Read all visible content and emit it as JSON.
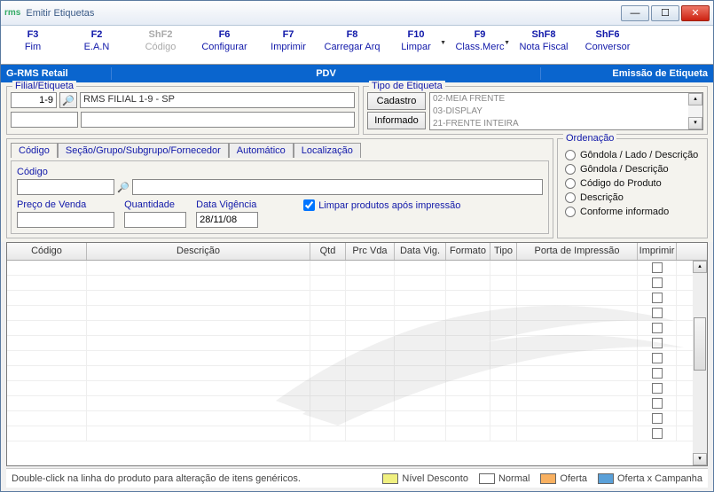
{
  "window": {
    "title": "Emitir Etiquetas"
  },
  "toolbar": [
    {
      "shortcut": "F3",
      "label": "Fim",
      "disabled": false
    },
    {
      "shortcut": "F2",
      "label": "E.A.N",
      "disabled": false
    },
    {
      "shortcut": "ShF2",
      "label": "Código",
      "disabled": true
    },
    {
      "shortcut": "F6",
      "label": "Configurar",
      "disabled": false
    },
    {
      "shortcut": "F7",
      "label": "Imprimir",
      "disabled": false
    },
    {
      "shortcut": "F8",
      "label": "Carregar Arq",
      "disabled": false
    },
    {
      "shortcut": "F10",
      "label": "Limpar",
      "disabled": false,
      "dropdown": true
    },
    {
      "shortcut": "F9",
      "label": "Class.Merc",
      "disabled": false,
      "dropdown": true
    },
    {
      "shortcut": "ShF8",
      "label": "Nota Fiscal",
      "disabled": false
    },
    {
      "shortcut": "ShF6",
      "label": "Conversor",
      "disabled": false
    }
  ],
  "bluebar": {
    "left": "G-RMS Retail",
    "mid": "PDV",
    "right": "Emissão de Etiqueta"
  },
  "filial": {
    "legend": "Filial/Etiqueta",
    "code": "1-9",
    "desc": "RMS FILIAL 1-9 - SP",
    "etq_code": "",
    "etq_desc": ""
  },
  "tipo": {
    "legend": "Tipo de Etiqueta",
    "btn_cadastro": "Cadastro",
    "btn_informado": "Informado",
    "options": [
      "02-MEIA FRENTE",
      "03-DISPLAY",
      "21-FRENTE INTEIRA"
    ]
  },
  "tabs": {
    "items": [
      {
        "label": "Código",
        "underline": "ó"
      },
      {
        "label": "Seção/Grupo/Subgrupo/Fornecedor",
        "underline": "S"
      },
      {
        "label": "Automático",
        "underline": "A"
      },
      {
        "label": "Localização",
        "underline": "L"
      }
    ],
    "active": 0
  },
  "fields": {
    "codigo_label": "Código",
    "preco_label": "Preço de Venda",
    "qtd_label": "Quantidade",
    "data_label": "Data Vigência",
    "data_value": "28/11/08",
    "check_label": "Limpar produtos após impressão"
  },
  "ordenacao": {
    "legend": "Ordenação",
    "options": [
      "Gôndola / Lado / Descrição",
      "Gôndola / Descrição",
      "Código do Produto",
      "Descrição",
      "Conforme informado"
    ]
  },
  "grid": {
    "headers": [
      "Código",
      "Descrição",
      "Qtd",
      "Prc Vda",
      "Data Vig.",
      "Formato",
      "Tipo",
      "Porta de Impressão",
      "Imprimir"
    ],
    "rows": 12
  },
  "statusbar": {
    "hint": "Double-click na linha do produto para alteração de itens genéricos.",
    "legend": [
      {
        "label": "Nível Desconto",
        "color": "#f0f080"
      },
      {
        "label": "Normal",
        "color": "#ffffff"
      },
      {
        "label": "Oferta",
        "color": "#f8b060"
      },
      {
        "label": "Oferta x Campanha",
        "color": "#5aa0d8"
      }
    ]
  }
}
